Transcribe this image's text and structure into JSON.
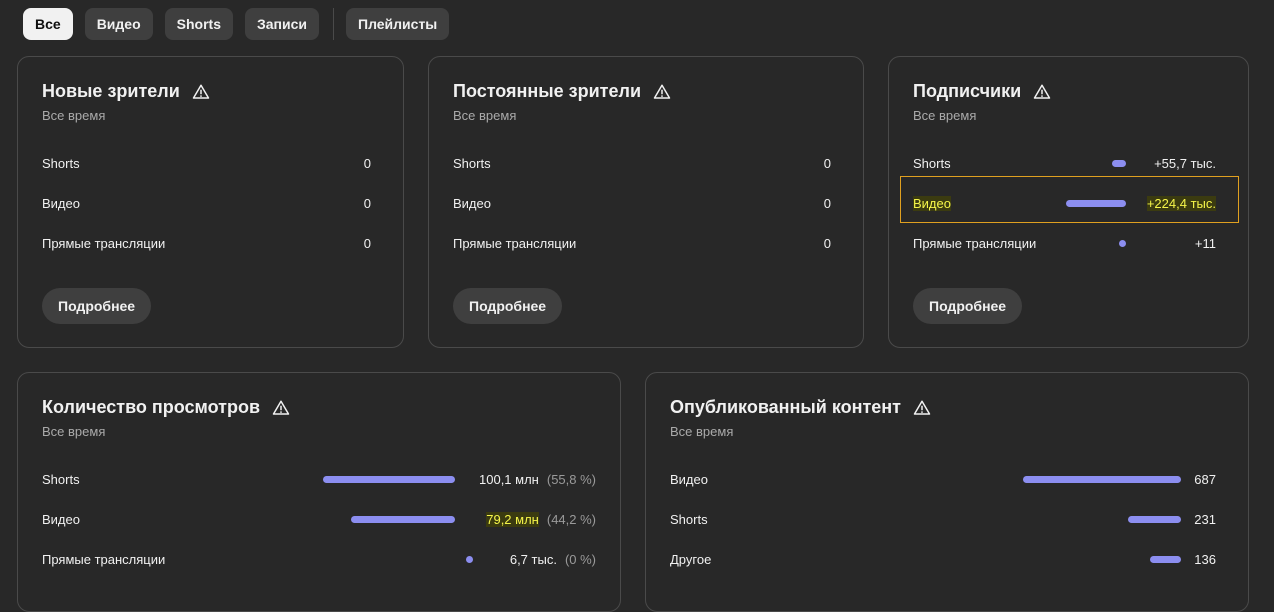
{
  "tabs": [
    "Все",
    "Видео",
    "Shorts",
    "Записи",
    "Плейлисты"
  ],
  "cards": {
    "new_viewers": {
      "title": "Новые зрители",
      "subtitle": "Все время",
      "rows": [
        {
          "label": "Shorts",
          "value": "0"
        },
        {
          "label": "Видео",
          "value": "0"
        },
        {
          "label": "Прямые трансляции",
          "value": "0"
        }
      ],
      "button": "Подробнее"
    },
    "returning_viewers": {
      "title": "Постоянные зрители",
      "subtitle": "Все время",
      "rows": [
        {
          "label": "Shorts",
          "value": "0"
        },
        {
          "label": "Видео",
          "value": "0"
        },
        {
          "label": "Прямые трансляции",
          "value": "0"
        }
      ],
      "button": "Подробнее"
    },
    "subscribers": {
      "title": "Подписчики",
      "subtitle": "Все время",
      "rows": [
        {
          "label": "Shorts",
          "value": "+55,7 тыс."
        },
        {
          "label": "Видео",
          "value": "+224,4 тыс."
        },
        {
          "label": "Прямые трансляции",
          "value": "+11"
        }
      ],
      "button": "Подробнее"
    },
    "views": {
      "title": "Количество просмотров",
      "subtitle": "Все время",
      "rows": [
        {
          "label": "Shorts",
          "value": "100,1 млн",
          "pct": "(55,8 %)"
        },
        {
          "label": "Видео",
          "value": "79,2 млн",
          "pct": "(44,2 %)"
        },
        {
          "label": "Прямые трансляции",
          "value": "6,7 тыс.",
          "pct": "(0 %)"
        }
      ]
    },
    "published": {
      "title": "Опубликованный контент",
      "subtitle": "Все время",
      "rows": [
        {
          "label": "Видео",
          "value": "687"
        },
        {
          "label": "Shorts",
          "value": "231"
        },
        {
          "label": "Другое",
          "value": "136"
        }
      ]
    }
  },
  "colors": {
    "bar": "#8c8ef0",
    "highlight_border": "#e0a020",
    "highlight_text": "#f5f54a"
  },
  "icons": {
    "warning": "warning-triangle-icon"
  }
}
